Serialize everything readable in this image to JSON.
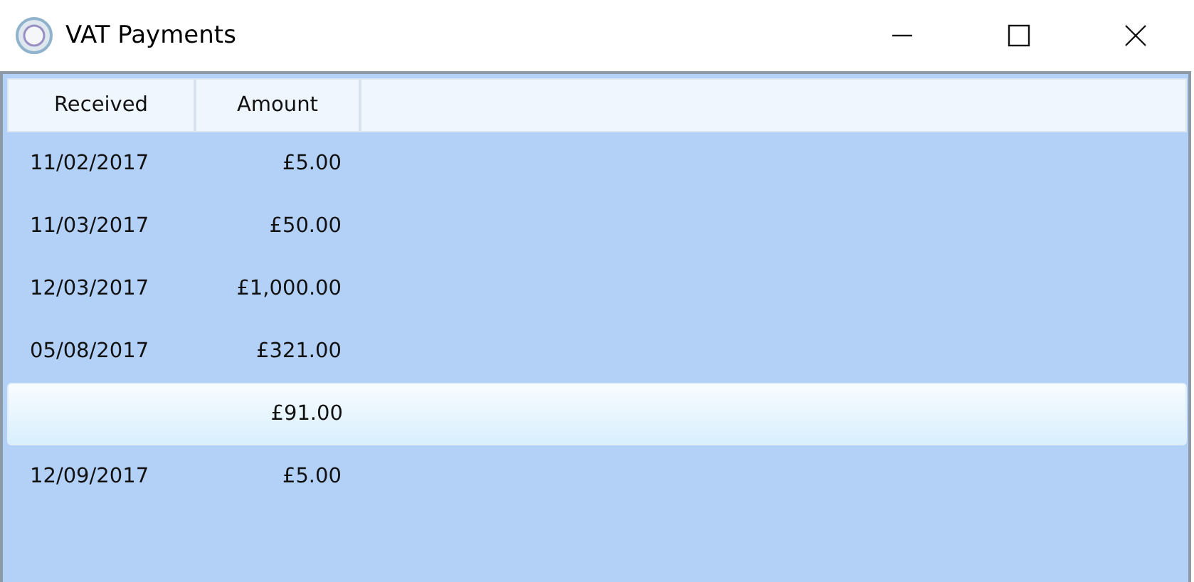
{
  "window": {
    "title": "VAT Payments"
  },
  "table": {
    "columns": [
      "Received",
      "Amount"
    ],
    "rows": [
      {
        "received": "11/02/2017",
        "amount": "£5.00",
        "selected": false
      },
      {
        "received": "11/03/2017",
        "amount": "£50.00",
        "selected": false
      },
      {
        "received": "12/03/2017",
        "amount": "£1,000.00",
        "selected": false
      },
      {
        "received": "05/08/2017",
        "amount": "£321.00",
        "selected": false
      },
      {
        "amount": "£91.00",
        "selected": true
      },
      {
        "received": "12/09/2017",
        "amount": "£5.00",
        "selected": false
      }
    ]
  }
}
